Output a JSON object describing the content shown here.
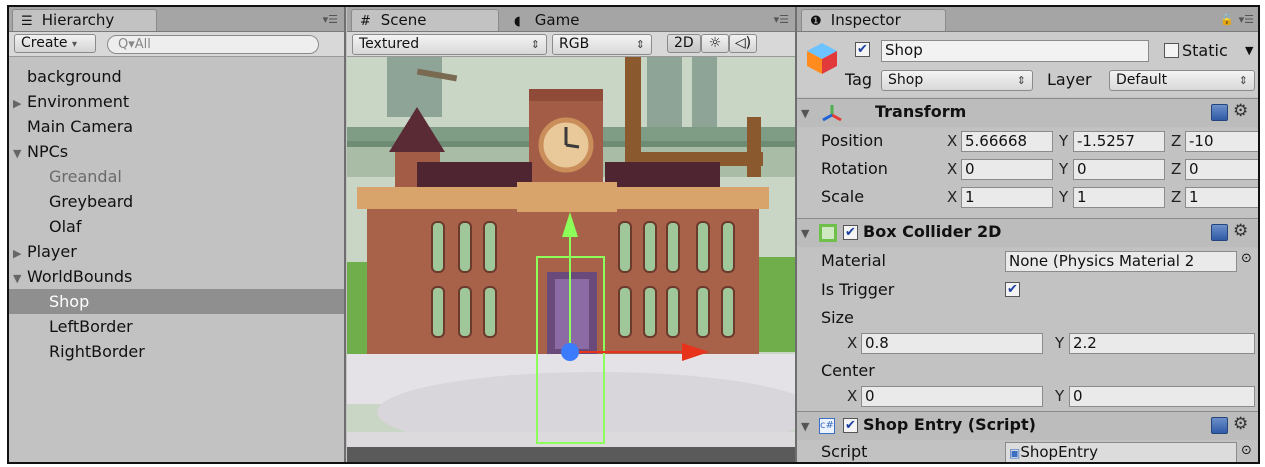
{
  "hierarchy": {
    "tab_label": "Hierarchy",
    "create_label": "Create",
    "search_placeholder": "All",
    "items": [
      {
        "label": "background",
        "indent": 0,
        "arrow": "",
        "state": "normal"
      },
      {
        "label": "Environment",
        "indent": 0,
        "arrow": "▶",
        "state": "normal"
      },
      {
        "label": "Main Camera",
        "indent": 0,
        "arrow": "",
        "state": "normal"
      },
      {
        "label": "NPCs",
        "indent": 0,
        "arrow": "▼",
        "state": "normal"
      },
      {
        "label": "Greandal",
        "indent": 1,
        "arrow": "",
        "state": "dim"
      },
      {
        "label": "Greybeard",
        "indent": 1,
        "arrow": "",
        "state": "normal"
      },
      {
        "label": "Olaf",
        "indent": 1,
        "arrow": "",
        "state": "normal"
      },
      {
        "label": "Player",
        "indent": 0,
        "arrow": "▶",
        "state": "normal"
      },
      {
        "label": "WorldBounds",
        "indent": 0,
        "arrow": "▼",
        "state": "normal"
      },
      {
        "label": "Shop",
        "indent": 1,
        "arrow": "",
        "state": "selected"
      },
      {
        "label": "LeftBorder",
        "indent": 1,
        "arrow": "",
        "state": "normal"
      },
      {
        "label": "RightBorder",
        "indent": 1,
        "arrow": "",
        "state": "normal"
      }
    ]
  },
  "scene": {
    "tab_scene": "Scene",
    "tab_game": "Game",
    "render_mode": "Textured",
    "color_mode": "RGB",
    "mode_2d": "2D"
  },
  "inspector": {
    "tab_label": "Inspector",
    "object_name": "Shop",
    "static_label": "Static",
    "tag_label": "Tag",
    "tag_value": "Shop",
    "layer_label": "Layer",
    "layer_value": "Default",
    "transform": {
      "title": "Transform",
      "position_label": "Position",
      "rotation_label": "Rotation",
      "scale_label": "Scale",
      "position": {
        "x": "5.66668",
        "y": "-1.5257",
        "z": "-10"
      },
      "rotation": {
        "x": "0",
        "y": "0",
        "z": "0"
      },
      "scale": {
        "x": "1",
        "y": "1",
        "z": "1"
      }
    },
    "box_collider": {
      "title": "Box Collider 2D",
      "material_label": "Material",
      "material_value": "None (Physics Material 2",
      "is_trigger_label": "Is Trigger",
      "size_label": "Size",
      "size_x": "0.8",
      "size_y": "2.2",
      "center_label": "Center",
      "center_x": "0",
      "center_y": "0"
    },
    "shop_entry": {
      "title": "Shop Entry (Script)",
      "script_label": "Script",
      "script_value": "ShopEntry"
    },
    "axis": {
      "x": "X",
      "y": "Y",
      "z": "Z"
    }
  },
  "colors": {
    "selection": "#8f8f8f",
    "panel_bg": "#c2c2c2",
    "collider_green": "#8cff5a",
    "gizmo_red": "#e8331c",
    "gizmo_blue": "#3b7cff"
  }
}
